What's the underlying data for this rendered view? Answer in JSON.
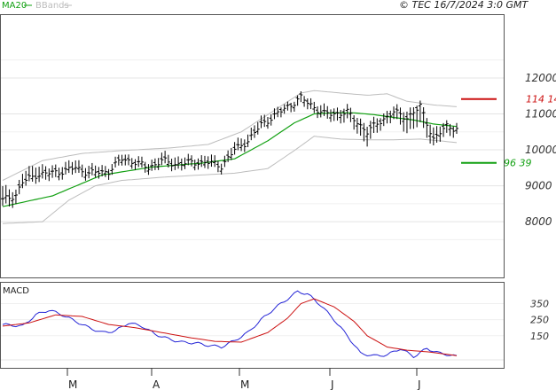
{
  "header": {
    "ma_label": "MA20",
    "bb_label": "BBands",
    "copyright": "© TEC 16/7/2024 3:0 GMT"
  },
  "colors": {
    "price": "#000000",
    "ma": "#12a012",
    "bbands": "#bdbdbd",
    "target_high": "#cc1111",
    "target_low": "#12a012",
    "macd": "#2424d6",
    "signal": "#cc1111",
    "grid": "#e4e4e4",
    "axis": "#333333"
  },
  "chart_data": [
    {
      "type": "line",
      "name": "price",
      "x_ticks": [
        "M",
        "A",
        "M",
        "J",
        "J"
      ],
      "y_ticks": [
        "12000",
        "11000",
        "10000",
        "9000",
        "8000"
      ],
      "y_tick_values": [
        12000,
        11000,
        10000,
        9000,
        8000
      ],
      "ylim": [
        6450,
        13750
      ],
      "n_bars": 138,
      "annotations": [
        {
          "label": "114 14",
          "value": 11414,
          "color": "#cc1111"
        },
        {
          "label": "96 39",
          "value": 9639,
          "color": "#12a012"
        }
      ],
      "bar_data_anchors": [
        [
          0,
          8600,
          8950,
          8400
        ],
        [
          4,
          8750,
          8900,
          8500
        ],
        [
          6,
          9100,
          9350,
          8950
        ],
        [
          10,
          9300,
          9600,
          9150
        ],
        [
          14,
          9350,
          9500,
          9150
        ],
        [
          18,
          9400,
          9600,
          9250
        ],
        [
          22,
          9500,
          9700,
          9350
        ],
        [
          26,
          9350,
          9550,
          9200
        ],
        [
          32,
          9400,
          9550,
          9250
        ],
        [
          36,
          9750,
          9900,
          9600
        ],
        [
          40,
          9650,
          9800,
          9500
        ],
        [
          44,
          9500,
          9650,
          9350
        ],
        [
          48,
          9700,
          9900,
          9550
        ],
        [
          52,
          9600,
          9800,
          9450
        ],
        [
          58,
          9650,
          9800,
          9500
        ],
        [
          62,
          9650,
          9850,
          9500
        ],
        [
          66,
          9550,
          9700,
          9400
        ],
        [
          70,
          10000,
          10200,
          9850
        ],
        [
          74,
          10250,
          10450,
          10100
        ],
        [
          78,
          10700,
          10900,
          10550
        ],
        [
          82,
          10950,
          11100,
          10800
        ],
        [
          86,
          11200,
          11300,
          11050
        ],
        [
          90,
          11450,
          11550,
          11250
        ],
        [
          93,
          11250,
          11400,
          11100
        ],
        [
          97,
          11000,
          11200,
          10850
        ],
        [
          100,
          11000,
          11150,
          10800
        ],
        [
          104,
          11050,
          11200,
          10800
        ],
        [
          106,
          10850,
          11000,
          10600
        ],
        [
          110,
          10500,
          10700,
          10150
        ],
        [
          114,
          10800,
          10950,
          10600
        ],
        [
          118,
          11050,
          11200,
          10850
        ],
        [
          122,
          10900,
          11100,
          10500
        ],
        [
          126,
          11200,
          11300,
          10700
        ],
        [
          130,
          10300,
          10600,
          10100
        ],
        [
          134,
          10650,
          10750,
          10400
        ],
        [
          137,
          10600,
          10750,
          10450
        ]
      ],
      "ma20_anchors": [
        [
          0,
          8420
        ],
        [
          15,
          8720
        ],
        [
          30,
          9300
        ],
        [
          45,
          9520
        ],
        [
          60,
          9630
        ],
        [
          70,
          9750
        ],
        [
          80,
          10250
        ],
        [
          88,
          10750
        ],
        [
          94,
          11000
        ],
        [
          100,
          11030
        ],
        [
          106,
          11030
        ],
        [
          112,
          10980
        ],
        [
          118,
          10900
        ],
        [
          124,
          10830
        ],
        [
          130,
          10720
        ],
        [
          137,
          10650
        ]
      ],
      "bb_upper_anchors": [
        [
          0,
          9150
        ],
        [
          12,
          9700
        ],
        [
          24,
          9900
        ],
        [
          36,
          9980
        ],
        [
          50,
          10050
        ],
        [
          62,
          10150
        ],
        [
          72,
          10500
        ],
        [
          82,
          11100
        ],
        [
          90,
          11580
        ],
        [
          94,
          11650
        ],
        [
          102,
          11580
        ],
        [
          110,
          11520
        ],
        [
          116,
          11560
        ],
        [
          122,
          11350
        ],
        [
          130,
          11250
        ],
        [
          137,
          11200
        ]
      ],
      "bb_lower_anchors": [
        [
          0,
          7950
        ],
        [
          12,
          8000
        ],
        [
          20,
          8600
        ],
        [
          28,
          9000
        ],
        [
          36,
          9150
        ],
        [
          50,
          9250
        ],
        [
          60,
          9300
        ],
        [
          70,
          9350
        ],
        [
          80,
          9480
        ],
        [
          88,
          9980
        ],
        [
          94,
          10380
        ],
        [
          102,
          10300
        ],
        [
          110,
          10280
        ],
        [
          118,
          10280
        ],
        [
          126,
          10300
        ],
        [
          132,
          10250
        ],
        [
          137,
          10200
        ]
      ]
    },
    {
      "type": "line",
      "name": "MACD",
      "title": "MACD",
      "y_ticks": [
        "350",
        "250",
        "150"
      ],
      "y_tick_values": [
        350,
        250,
        150
      ],
      "ylim": [
        -50,
        480
      ],
      "series": [
        {
          "name": "MACD",
          "points": [
            [
              0,
              220
            ],
            [
              6,
              210
            ],
            [
              10,
              280
            ],
            [
              14,
              310
            ],
            [
              18,
              280
            ],
            [
              22,
              240
            ],
            [
              26,
              200
            ],
            [
              30,
              170
            ],
            [
              34,
              180
            ],
            [
              38,
              230
            ],
            [
              42,
              210
            ],
            [
              46,
              160
            ],
            [
              50,
              130
            ],
            [
              54,
              110
            ],
            [
              58,
              105
            ],
            [
              62,
              90
            ],
            [
              66,
              80
            ],
            [
              70,
              120
            ],
            [
              74,
              170
            ],
            [
              78,
              250
            ],
            [
              82,
              320
            ],
            [
              86,
              380
            ],
            [
              89,
              425
            ],
            [
              92,
              410
            ],
            [
              96,
              340
            ],
            [
              100,
              250
            ],
            [
              104,
              150
            ],
            [
              108,
              40
            ],
            [
              112,
              25
            ],
            [
              116,
              30
            ],
            [
              120,
              70
            ],
            [
              124,
              20
            ],
            [
              128,
              70
            ],
            [
              132,
              40
            ],
            [
              135,
              30
            ],
            [
              137,
              20
            ]
          ]
        },
        {
          "name": "Signal",
          "points": [
            [
              0,
              210
            ],
            [
              8,
              230
            ],
            [
              16,
              280
            ],
            [
              24,
              270
            ],
            [
              32,
              220
            ],
            [
              40,
              200
            ],
            [
              48,
              170
            ],
            [
              56,
              140
            ],
            [
              64,
              115
            ],
            [
              72,
              110
            ],
            [
              80,
              170
            ],
            [
              86,
              260
            ],
            [
              90,
              350
            ],
            [
              94,
              380
            ],
            [
              100,
              330
            ],
            [
              106,
              240
            ],
            [
              110,
              150
            ],
            [
              116,
              80
            ],
            [
              122,
              60
            ],
            [
              128,
              50
            ],
            [
              134,
              35
            ],
            [
              137,
              25
            ]
          ]
        }
      ]
    }
  ]
}
